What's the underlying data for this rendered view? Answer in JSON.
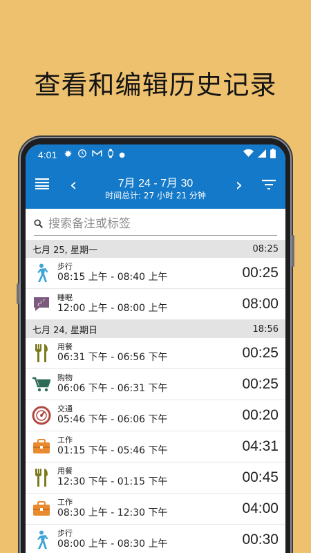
{
  "headline": "查看和编辑历史记录",
  "status": {
    "time": "4:01"
  },
  "toolbar": {
    "title": "7月 24 - 7月 30",
    "subtitle": "时间总计: 27 小时 21 分钟",
    "prev": "‹",
    "next": "›"
  },
  "search": {
    "placeholder": "搜索备注或标签"
  },
  "days": [
    {
      "label": "七月 25, 星期一",
      "total": "08:25",
      "entries": [
        {
          "category": "步行",
          "range": "08:15 上午 - 08:40 上午",
          "duration": "00:25",
          "icon": "walking-icon"
        },
        {
          "category": "睡眠",
          "range": "12:00 上午 - 08:00 上午",
          "duration": "08:00",
          "icon": "sleep-icon"
        }
      ]
    },
    {
      "label": "七月 24, 星期日",
      "total": "18:56",
      "entries": [
        {
          "category": "用餐",
          "range": "06:31 下午 - 06:56 下午",
          "duration": "00:25",
          "icon": "meal-icon"
        },
        {
          "category": "购物",
          "range": "06:06 下午 - 06:31 下午",
          "duration": "00:25",
          "icon": "shopping-cart-icon"
        },
        {
          "category": "交通",
          "range": "05:46 下午 - 06:06 下午",
          "duration": "00:20",
          "icon": "transport-icon"
        },
        {
          "category": "工作",
          "range": "01:15 下午 - 05:46 下午",
          "duration": "04:31",
          "icon": "briefcase-icon"
        },
        {
          "category": "用餐",
          "range": "12:30 下午 - 01:15 下午",
          "duration": "00:45",
          "icon": "meal-icon"
        },
        {
          "category": "工作",
          "range": "08:30 上午 - 12:30 下午",
          "duration": "04:00",
          "icon": "briefcase-icon"
        },
        {
          "category": "步行",
          "range": "08:00 上午 - 08:30 上午",
          "duration": "00:30",
          "icon": "walking-icon"
        }
      ]
    }
  ],
  "colors": {
    "background": "#EEC16F",
    "appbar": "#1479C8",
    "walking": "#3DA5D9",
    "sleep": "#7B5A7E",
    "meal": "#7E7A1E",
    "shopping": "#2E6B57",
    "transport": "#B0463F",
    "work": "#E98A2E"
  }
}
